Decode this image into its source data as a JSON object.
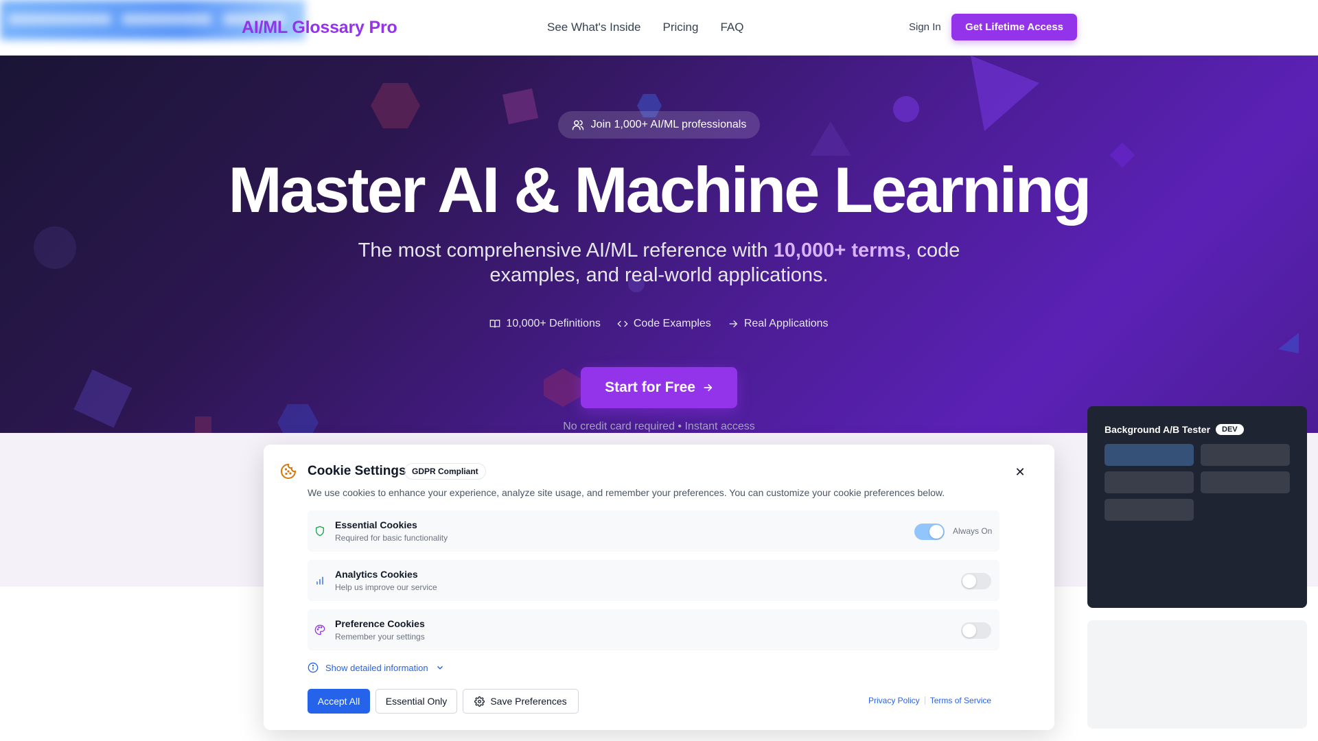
{
  "header": {
    "logo": "AI/ML Glossary Pro",
    "nav": [
      "See What's Inside",
      "Pricing",
      "FAQ"
    ],
    "sign_in": "Sign In",
    "cta": "Get Lifetime Access"
  },
  "hero": {
    "badge": "Join 1,000+ AI/ML professionals",
    "title": "Master AI & Machine Learning",
    "subtitle_before": "The most comprehensive AI/ML reference with ",
    "subtitle_highlight": "10,000+ terms",
    "subtitle_after": ", code examples, and real-world applications.",
    "features": [
      "10,000+ Definitions",
      "Code Examples",
      "Real Applications"
    ],
    "start_button": "Start for Free",
    "note": "No credit card required • Instant access"
  },
  "dev_panel": {
    "title": "Background A/B Tester",
    "tag": "DEV"
  },
  "cookie": {
    "title": "Cookie Settings",
    "badge": "GDPR Compliant",
    "description": "We use cookies to enhance your experience, analyze site usage, and remember your preferences. You can customize your cookie preferences below.",
    "rows": [
      {
        "name": "Essential Cookies",
        "desc": "Required for basic functionality",
        "state": "on",
        "note": "Always On"
      },
      {
        "name": "Analytics Cookies",
        "desc": "Help us improve our service",
        "state": "off"
      },
      {
        "name": "Preference Cookies",
        "desc": "Remember your settings",
        "state": "off"
      }
    ],
    "details_link": "Show detailed information",
    "buttons": {
      "accept_all": "Accept All",
      "essential_only": "Essential Only",
      "save": "Save Preferences"
    },
    "links": {
      "privacy": "Privacy Policy",
      "terms": "Terms of Service"
    }
  },
  "colors": {
    "brand_purple": "#9333ea",
    "accent_blue": "#2563eb",
    "highlight": "#d8b4fe"
  }
}
